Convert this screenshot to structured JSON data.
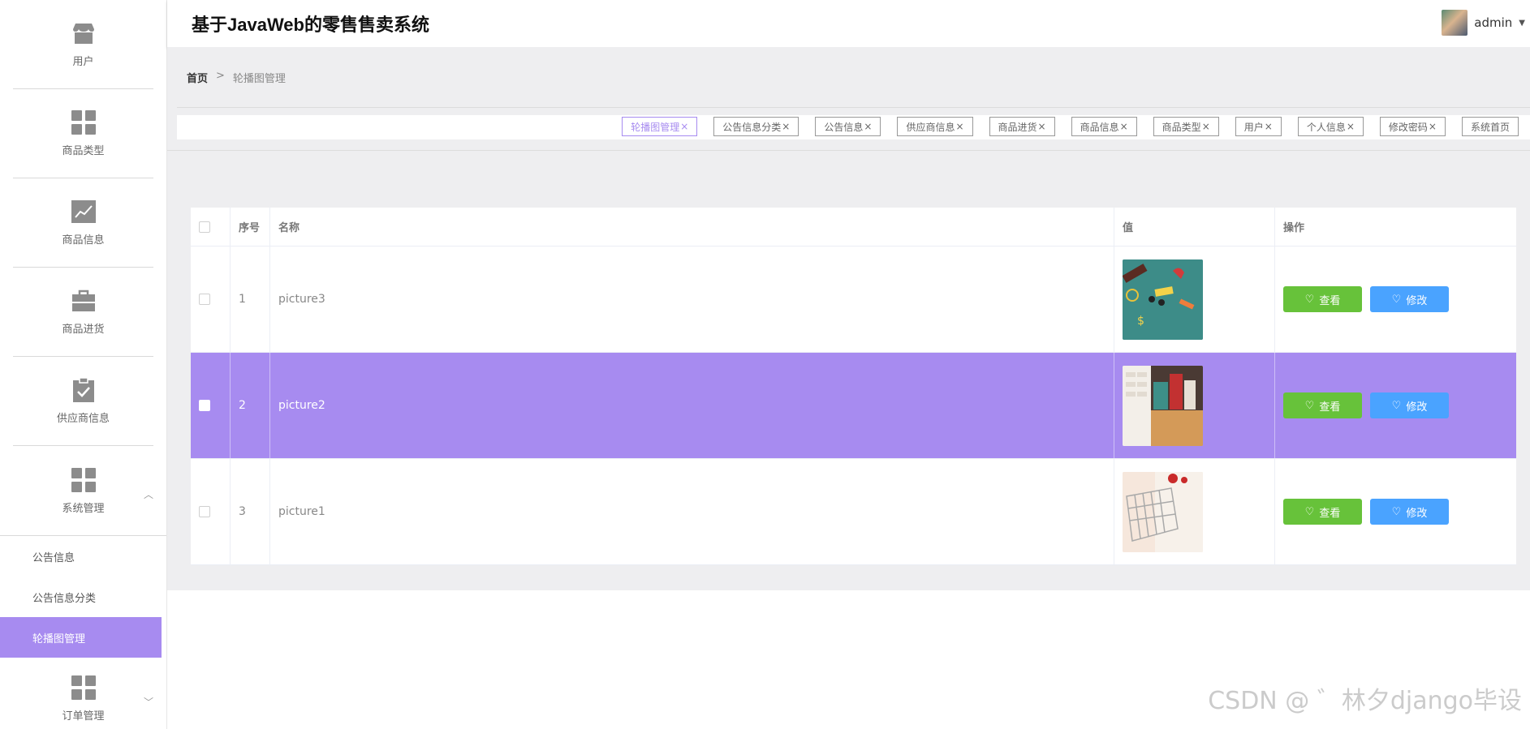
{
  "header": {
    "title": "基于JavaWeb的零售售卖系统",
    "username": "admin"
  },
  "sidebar": {
    "items": [
      {
        "label": "用户",
        "icon": "store-icon"
      },
      {
        "label": "商品类型",
        "icon": "grid-icon"
      },
      {
        "label": "商品信息",
        "icon": "chart-icon"
      },
      {
        "label": "商品进货",
        "icon": "briefcase-icon"
      },
      {
        "label": "供应商信息",
        "icon": "clipboard-check-icon"
      },
      {
        "label": "系统管理",
        "icon": "grid-icon"
      },
      {
        "label": "订单管理",
        "icon": "grid-icon"
      }
    ],
    "submenu": [
      "公告信息",
      "公告信息分类",
      "轮播图管理"
    ]
  },
  "breadcrumb": {
    "home": "首页",
    "separator": ">",
    "current": "轮播图管理"
  },
  "tabs": [
    "轮播图管理",
    "公告信息分类",
    "公告信息",
    "供应商信息",
    "商品进货",
    "商品信息",
    "商品类型",
    "用户",
    "个人信息",
    "修改密码",
    "系统首页"
  ],
  "tab_close": "×",
  "table": {
    "columns": [
      "序号",
      "名称",
      "值",
      "操作"
    ],
    "rows": [
      {
        "no": "1",
        "name": "picture3"
      },
      {
        "no": "2",
        "name": "picture2"
      },
      {
        "no": "3",
        "name": "picture1"
      }
    ],
    "view_label": "查看",
    "edit_label": "修改"
  },
  "watermark": "CSDN @ ゛林夕django毕设",
  "colors": {
    "accent": "#a78bf0",
    "view_button": "#67c23a",
    "edit_button": "#4aa3ff"
  }
}
